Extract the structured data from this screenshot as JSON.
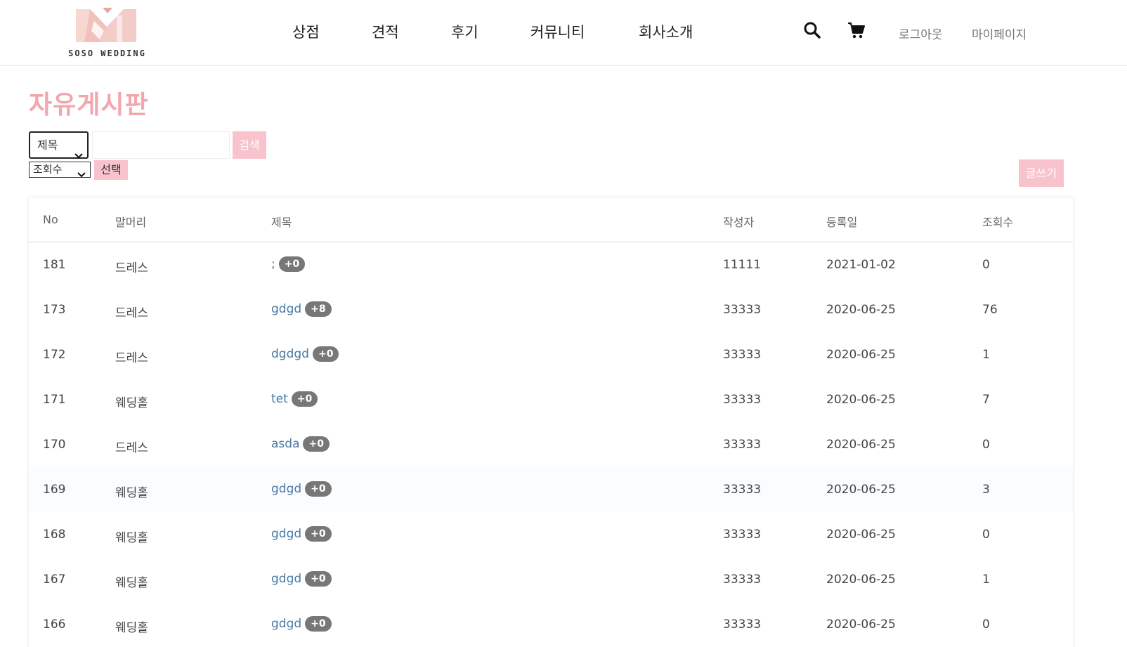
{
  "header": {
    "logo_text": "SOSO WEDDING",
    "nav": [
      "상점",
      "견적",
      "후기",
      "커뮤니티",
      "회사소개"
    ],
    "logout_label": "로그아웃",
    "mypage_label": "마이페이지"
  },
  "board": {
    "title": "자유게시판",
    "search_field_value": "제목",
    "search_button": "검색",
    "sort_value": "조회수",
    "sort_button": "선택",
    "write_button": "글쓰기"
  },
  "table": {
    "columns": [
      "No",
      "말머리",
      "제목",
      "작성자",
      "등록일",
      "조회수"
    ],
    "rows": [
      {
        "no": "181",
        "category": "드레스",
        "title": ";",
        "comments": "+0",
        "writer": "11111",
        "date": "2021-01-02",
        "views": "0"
      },
      {
        "no": "173",
        "category": "드레스",
        "title": "gdgd",
        "comments": "+8",
        "writer": "33333",
        "date": "2020-06-25",
        "views": "76"
      },
      {
        "no": "172",
        "category": "드레스",
        "title": "dgdgd",
        "comments": "+0",
        "writer": "33333",
        "date": "2020-06-25",
        "views": "1"
      },
      {
        "no": "171",
        "category": "웨딩홀",
        "title": "tet",
        "comments": "+0",
        "writer": "33333",
        "date": "2020-06-25",
        "views": "7"
      },
      {
        "no": "170",
        "category": "드레스",
        "title": "asda",
        "comments": "+0",
        "writer": "33333",
        "date": "2020-06-25",
        "views": "0"
      },
      {
        "no": "169",
        "category": "웨딩홀",
        "title": "gdgd",
        "comments": "+0",
        "writer": "33333",
        "date": "2020-06-25",
        "views": "3"
      },
      {
        "no": "168",
        "category": "웨딩홀",
        "title": "gdgd",
        "comments": "+0",
        "writer": "33333",
        "date": "2020-06-25",
        "views": "0"
      },
      {
        "no": "167",
        "category": "웨딩홀",
        "title": "gdgd",
        "comments": "+0",
        "writer": "33333",
        "date": "2020-06-25",
        "views": "1"
      },
      {
        "no": "166",
        "category": "웨딩홀",
        "title": "gdgd",
        "comments": "+0",
        "writer": "33333",
        "date": "2020-06-25",
        "views": "0"
      }
    ]
  },
  "colors": {
    "accent_pink": "#f2a7ad",
    "button_pink": "#f9c3cd",
    "link_blue": "#4a7aa5",
    "badge_gray": "#777777"
  },
  "icons": [
    "search-icon",
    "cart-icon",
    "chevron-down-icon"
  ]
}
